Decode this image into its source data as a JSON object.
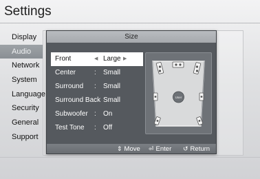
{
  "app_title": "Settings",
  "sidebar": {
    "items": [
      {
        "label": "Display",
        "selected": false
      },
      {
        "label": "Audio",
        "selected": true
      },
      {
        "label": "Network",
        "selected": false
      },
      {
        "label": "System",
        "selected": false
      },
      {
        "label": "Language",
        "selected": false
      },
      {
        "label": "Security",
        "selected": false
      },
      {
        "label": "General",
        "selected": false
      },
      {
        "label": "Support",
        "selected": false
      }
    ]
  },
  "dialog": {
    "title": "Size",
    "rows": [
      {
        "label": "Front",
        "separator": "",
        "value": "Large",
        "selected": true
      },
      {
        "label": "Center",
        "separator": ":",
        "value": "Small",
        "selected": false
      },
      {
        "label": "Surround",
        "separator": ":",
        "value": "Small",
        "selected": false
      },
      {
        "label": "Surround Back",
        "separator": ":",
        "value": "Small",
        "selected": false
      },
      {
        "label": "Subwoofer",
        "separator": ":",
        "value": "On",
        "selected": false
      },
      {
        "label": "Test Tone",
        "separator": ":",
        "value": "Off",
        "selected": false
      }
    ],
    "diagram": {
      "listener_label": "User",
      "speaker_icons": [
        "front-left-speaker-icon",
        "center-speaker-icon",
        "front-right-speaker-icon",
        "surround-left-speaker-icon",
        "surround-right-speaker-icon",
        "rear-left-speaker-icon",
        "rear-right-speaker-icon"
      ]
    },
    "footer": {
      "move_label": "Move",
      "enter_label": "Enter",
      "return_label": "Return",
      "move_icon": "updown-arrows-icon",
      "enter_icon": "enter-icon",
      "return_icon": "return-icon"
    }
  },
  "colors": {
    "dialog_bg": "#55595e",
    "header_bg": "#a6a9ad",
    "selected_row": "#ffffff",
    "sidebar_selected": "#8f9499"
  }
}
